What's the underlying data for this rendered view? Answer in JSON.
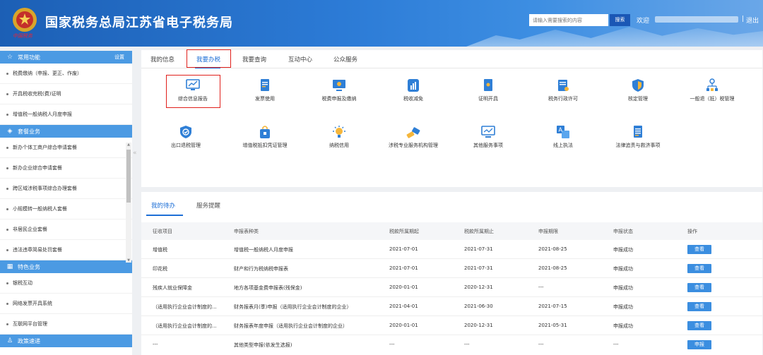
{
  "header": {
    "site_title": "国家税务总局江苏省电子税务局",
    "emblem_tag": "中国税务",
    "search_placeholder": "请输入需要搜索的内容",
    "search_button": "搜索",
    "welcome": "欢迎",
    "separator": "|",
    "logout": "退出"
  },
  "sidebar": {
    "sections": [
      {
        "title": "常用功能",
        "icon": "star-icon",
        "extra": "设置"
      },
      {
        "title": "套餐业务",
        "icon": "layers-icon"
      },
      {
        "title": "特色业务",
        "icon": "grid-icon"
      },
      {
        "title": "政策速递",
        "icon": "person-icon"
      }
    ],
    "common": [
      "税费缴纳（申报、更正、作废）",
      "开具税收完税(费)证明",
      "增值税一般纳税人月度申报"
    ],
    "packages": [
      "新办个体工商户综合申请套餐",
      "新办企业综合申请套餐",
      "跨区域涉税事项综合办理套餐",
      "小规模转一般纳税人套餐",
      "非居民企业套餐",
      "违法违章简易处罚套餐"
    ],
    "special": [
      "银税互动",
      "网络发票开具系统",
      "互联网平台管理"
    ]
  },
  "top_tabs": [
    "我的信息",
    "我要办税",
    "我要查询",
    "互动中心",
    "公众服务"
  ],
  "services": [
    {
      "label": "综合信息报告",
      "icon": "monitor-chart-icon"
    },
    {
      "label": "发票使用",
      "icon": "invoice-icon"
    },
    {
      "label": "税费申报及缴纳",
      "icon": "screen-icon"
    },
    {
      "label": "税收减免",
      "icon": "bar-chart-icon"
    },
    {
      "label": "证明开具",
      "icon": "certificate-icon"
    },
    {
      "label": "税务行政许可",
      "icon": "license-icon"
    },
    {
      "label": "核定管理",
      "icon": "shield-icon"
    },
    {
      "label": "一般退（抵）税管理",
      "icon": "org-chart-icon"
    },
    {
      "label": "出口退税管理",
      "icon": "shield-check-icon"
    },
    {
      "label": "增值税抵扣凭证管理",
      "icon": "bag-icon"
    },
    {
      "label": "纳税信用",
      "icon": "bulb-icon"
    },
    {
      "label": "涉税专业服务机构管理",
      "icon": "tools-icon"
    },
    {
      "label": "其他服务事项",
      "icon": "monitor-line-icon"
    },
    {
      "label": "线上执法",
      "icon": "translate-icon"
    },
    {
      "label": "法律追责与救济事项",
      "icon": "document-icon"
    }
  ],
  "todo": {
    "tabs": [
      "我的待办",
      "服务提醒"
    ],
    "columns": [
      "征收项目",
      "申报表种类",
      "税款所属期起",
      "税款所属期止",
      "申报期限",
      "申报状态",
      "操作"
    ],
    "rows": [
      [
        "增值税",
        "增值税一般纳税人月度申报",
        "2021-07-01",
        "2021-07-31",
        "2021-08-25",
        "申报成功",
        "查看"
      ],
      [
        "印花税",
        "财产和行为税纳税申报表",
        "2021-07-01",
        "2021-07-31",
        "2021-08-25",
        "申报成功",
        "查看"
      ],
      [
        "残疾人就业保障金",
        "地方各项基金费申报表(残保金)",
        "2020-01-01",
        "2020-12-31",
        "---",
        "申报成功",
        "查看"
      ],
      [
        "（适用执行企业会计制度的...",
        "财务报表月(季)申报（适用执行企业会计制度的企业）",
        "2021-04-01",
        "2021-06-30",
        "2021-07-15",
        "申报成功",
        "查看"
      ],
      [
        "（适用执行企业会计制度的...",
        "财务报表年度申报（适用执行企业会计制度的企业）",
        "2020-01-01",
        "2020-12-31",
        "2021-05-31",
        "申报成功",
        "查看"
      ],
      [
        "---",
        "其他类型申报(依发生选报)",
        "---",
        "---",
        "---",
        "---",
        "申报"
      ]
    ]
  },
  "colors": {
    "header": "#2c7bd6",
    "accent": "#1d6fd6",
    "section": "#4b9ae3",
    "button": "#3b8ee0",
    "highlight": "#e0201c"
  }
}
